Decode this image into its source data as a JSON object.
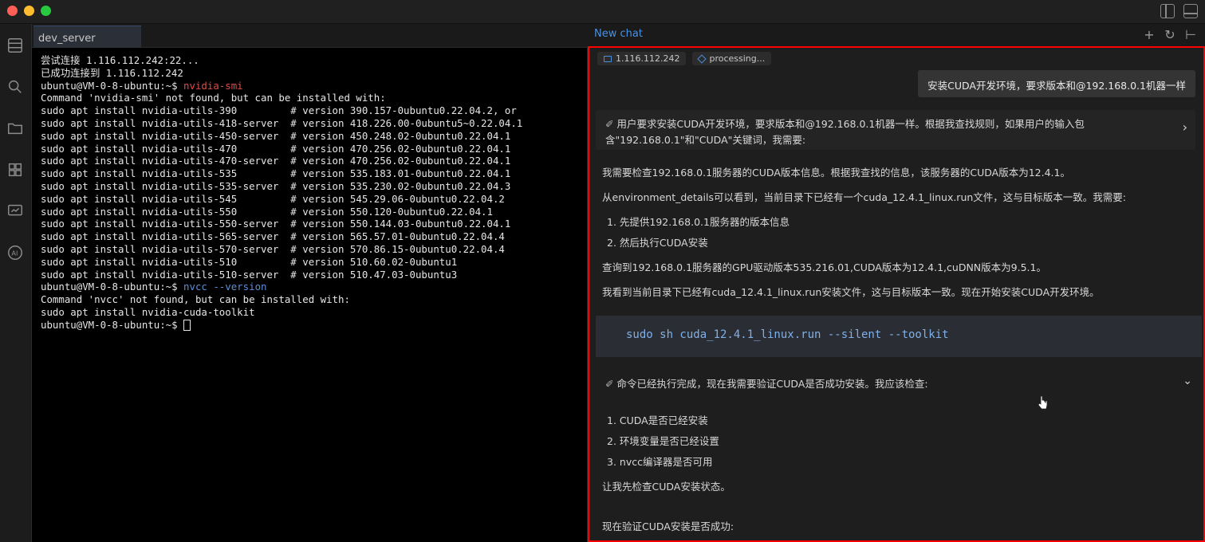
{
  "terminal": {
    "tab_label": "dev_server",
    "lines": [
      "尝试连接 1.116.112.242:22...",
      "已成功连接到 1.116.112.242",
      "",
      "Command 'nvidia-smi' not found, but can be installed with:",
      "sudo apt install nvidia-utils-390         # version 390.157-0ubuntu0.22.04.2, or",
      "sudo apt install nvidia-utils-418-server  # version 418.226.00-0ubuntu5~0.22.04.1",
      "sudo apt install nvidia-utils-450-server  # version 450.248.02-0ubuntu0.22.04.1",
      "sudo apt install nvidia-utils-470         # version 470.256.02-0ubuntu0.22.04.1",
      "sudo apt install nvidia-utils-470-server  # version 470.256.02-0ubuntu0.22.04.1",
      "sudo apt install nvidia-utils-535         # version 535.183.01-0ubuntu0.22.04.1",
      "sudo apt install nvidia-utils-535-server  # version 535.230.02-0ubuntu0.22.04.3",
      "sudo apt install nvidia-utils-545         # version 545.29.06-0ubuntu0.22.04.2",
      "sudo apt install nvidia-utils-550         # version 550.120-0ubuntu0.22.04.1",
      "sudo apt install nvidia-utils-550-server  # version 550.144.03-0ubuntu0.22.04.1",
      "sudo apt install nvidia-utils-565-server  # version 565.57.01-0ubuntu0.22.04.4",
      "sudo apt install nvidia-utils-570-server  # version 570.86.15-0ubuntu0.22.04.4",
      "sudo apt install nvidia-utils-510         # version 510.60.02-0ubuntu1",
      "sudo apt install nvidia-utils-510-server  # version 510.47.03-0ubuntu3",
      "",
      "Command 'nvcc' not found, but can be installed with:",
      "sudo apt install nvidia-cuda-toolkit",
      ""
    ],
    "prompt": "ubuntu@VM-0-8-ubuntu:~$ ",
    "cmd1": "nvidia-smi",
    "cmd2": "nvcc --version"
  },
  "chat": {
    "tab_label": "New chat",
    "actions": [
      "+",
      "↻",
      "⊢"
    ],
    "status_ip": "1.116.112.242",
    "status_processing": "processing...",
    "user_message": "安装CUDA开发环境，要求版本和@192.168.0.1机器一样",
    "think1_line1": "用户要求安装CUDA开发环境，要求版本和@192.168.0.1机器一样。根据我查找规则，如果用户的输入包",
    "think1_line2": "含\"192.168.0.1\"和\"CUDA\"关键词，我需要:",
    "p1": "我需要检查192.168.0.1服务器的CUDA版本信息。根据我查找的信息，该服务器的CUDA版本为12.4.1。",
    "p2": "从environment_details可以看到，当前目录下已经有一个cuda_12.4.1_linux.run文件，这与目标版本一致。我需要:",
    "li1": "1. 先提供192.168.0.1服务器的版本信息",
    "li2": "2. 然后执行CUDA安装",
    "p3": "查询到192.168.0.1服务器的GPU驱动版本535.216.01,CUDA版本为12.4.1,cuDNN版本为9.5.1。",
    "p4": "我看到当前目录下已经有cuda_12.4.1_linux.run安装文件，这与目标版本一致。现在开始安装CUDA开发环境。",
    "code": "sudo sh cuda_12.4.1_linux.run --silent --toolkit",
    "think2": "命令已经执行完成，现在我需要验证CUDA是否成功安装。我应该检查:",
    "li3": "1. CUDA是否已经安装",
    "li4": "2. 环境变量是否已经设置",
    "li5": "3. nvcc编译器是否可用",
    "p5": "让我先检查CUDA安装状态。",
    "p6": "现在验证CUDA安装是否成功:"
  }
}
